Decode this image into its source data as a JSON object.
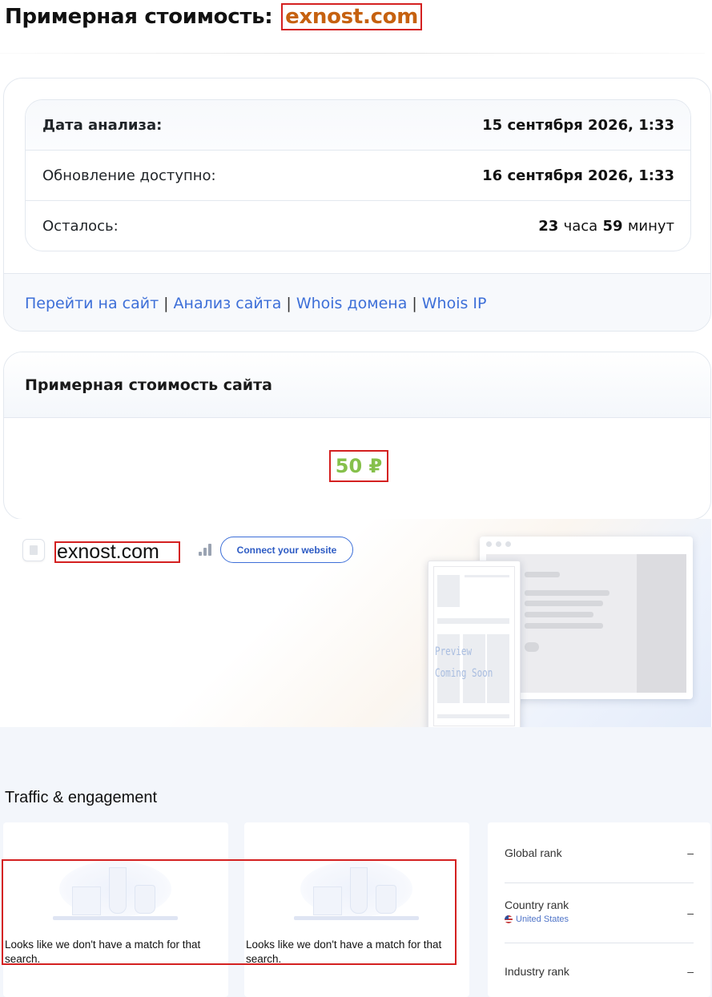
{
  "header": {
    "title_prefix": "Примерная стоимость:",
    "domain": "exnost.com"
  },
  "analysis": {
    "rows": [
      {
        "label": "Дата анализа:",
        "value": "15 сентября 2026, 1:33"
      },
      {
        "label": "Обновление доступно:",
        "value": "16 сентября 2026, 1:33"
      }
    ],
    "remaining": {
      "label": "Осталось:",
      "hours": "23",
      "hours_unit": "часа",
      "minutes": "59",
      "minutes_unit": "минут"
    }
  },
  "links": [
    {
      "label": "Перейти на сайт"
    },
    {
      "label": "Анализ сайта"
    },
    {
      "label": "Whois домена"
    },
    {
      "label": "Whois IP"
    }
  ],
  "link_separator": "|",
  "valuation": {
    "title": "Примерная стоимость сайта",
    "price": "50 ₽",
    "price_color": "#86c04b"
  },
  "site_preview": {
    "domain": "exnost.com",
    "connect_button": "Connect your website",
    "preview_line1": "Preview",
    "preview_line2": "Coming Soon",
    "icons": [
      "document-icon",
      "signal-bars-icon"
    ]
  },
  "traffic": {
    "title": "Traffic & engagement",
    "empty_message": "Looks like we don't have a match for that search.",
    "ranks": [
      {
        "label": "Global rank",
        "value": "–"
      },
      {
        "label": "Country rank",
        "value": "–",
        "country": "United States"
      },
      {
        "label": "Industry rank",
        "value": "–"
      }
    ]
  },
  "colors": {
    "link": "#3d6fd8",
    "highlight_border": "#d42020",
    "domain_accent": "#c6610f"
  }
}
